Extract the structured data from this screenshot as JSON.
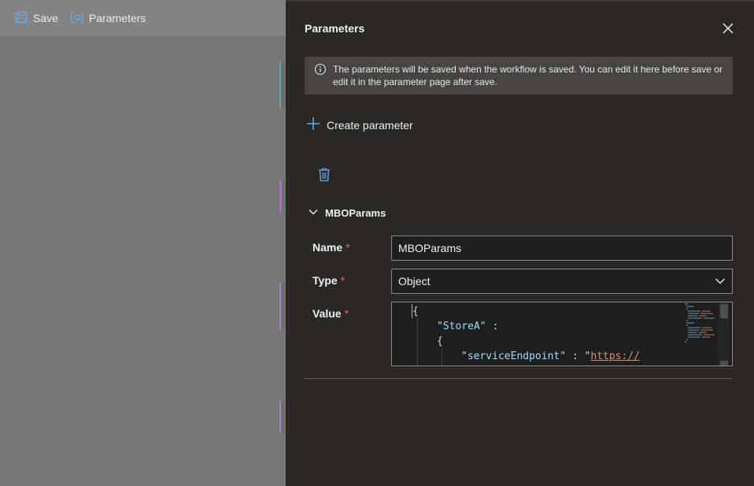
{
  "toolbar": {
    "save_label": "Save",
    "parameters_label": "Parameters"
  },
  "panel": {
    "title": "Parameters",
    "info_text": "The parameters will be saved when the workflow is saved. You can edit it here before save or edit it in the parameter page after save.",
    "create_label": "Create parameter"
  },
  "param": {
    "section_title": "MBOParams",
    "name_label": "Name",
    "type_label": "Type",
    "value_label": "Value",
    "required_mark": "*",
    "name_value": "MBOParams",
    "type_value": "Object",
    "code": {
      "line1": "{",
      "line2_key": "\"StoreA\"",
      "line2_rest": " :",
      "line3": "{",
      "line4_key": "\"serviceEndpoint\"",
      "line4_mid": " : \"",
      "line4_str": "https://"
    }
  },
  "colors": {
    "accent": "#6ba8e5",
    "required": "#d86a6a",
    "panel_bg": "#292827"
  },
  "icons": {
    "save": "save-icon",
    "parameters": "parameters-icon",
    "close": "close-icon",
    "info": "info-icon",
    "add": "plus-icon",
    "delete": "trash-icon",
    "chevron": "chevron-down-icon",
    "dropdown": "chevron-down-icon"
  }
}
